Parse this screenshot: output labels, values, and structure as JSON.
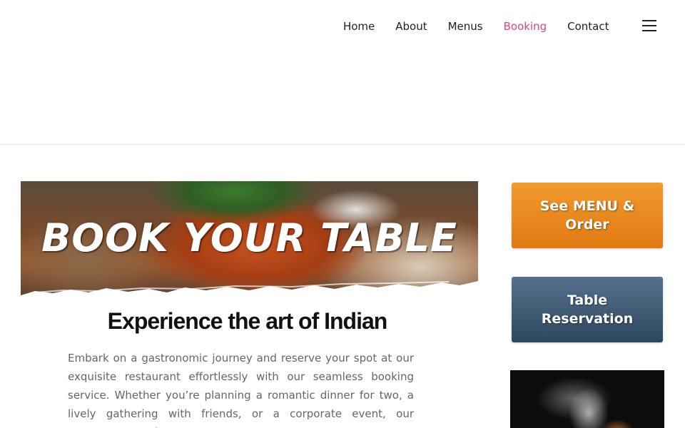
{
  "nav": {
    "items": [
      "Home",
      "About",
      "Menus",
      "Booking",
      "Contact"
    ],
    "active": "Booking",
    "menu_icon": "hamburger-icon"
  },
  "hero": {
    "title": "BOOK YOUR TABLE"
  },
  "main": {
    "headline": "Experience the art of Indian",
    "paragraph": "Embark on a gastronomic journey and reserve your spot at our exquisite restaurant effortlessly with our seamless booking service. Whether you’re planning a romantic dinner for two, a lively gathering with friends, or a corporate event, our restaurant promises an"
  },
  "sidebar": {
    "menu_button": "See MENU & Order",
    "reservation_button": "Table Reservation"
  },
  "colors": {
    "accent": "#e0457b",
    "menu_button": "#e8871c",
    "reservation_button": "#3f5a75"
  }
}
